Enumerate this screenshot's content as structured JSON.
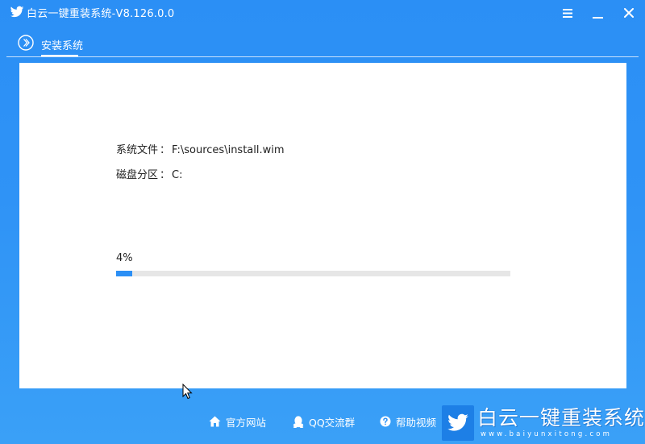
{
  "window": {
    "title": "白云一键重装系统-V8.126.0.0",
    "logo_icon": "bird-logo-icon",
    "controls": {
      "menu_icon": "menu-icon",
      "minimize_icon": "minimize-icon",
      "close_icon": "close-icon"
    }
  },
  "tab": {
    "icon": "chevron-circle-icon",
    "label": "安装系统"
  },
  "install_info": {
    "file_label": "系统文件",
    "file_value": "F:\\sources\\install.wim",
    "disk_label": "磁盘分区",
    "disk_value": "C:",
    "separator": "："
  },
  "progress": {
    "percent_text": "4%",
    "value": 0.04
  },
  "footer": {
    "links": [
      {
        "label": "官方网站",
        "icon": "home-icon"
      },
      {
        "label": "QQ交流群",
        "icon": "qq-penguin-icon"
      },
      {
        "label": "帮助视频",
        "icon": "help-icon"
      }
    ]
  },
  "brand": {
    "name": "白云一键重装系统",
    "url": "www.baiyunxitong.com",
    "icon": "bird-logo-icon"
  },
  "colors": {
    "background": "#2f93f6",
    "progress_fill": "#2b8ff5",
    "progress_track": "#e6e6e6",
    "panel": "#ffffff"
  }
}
